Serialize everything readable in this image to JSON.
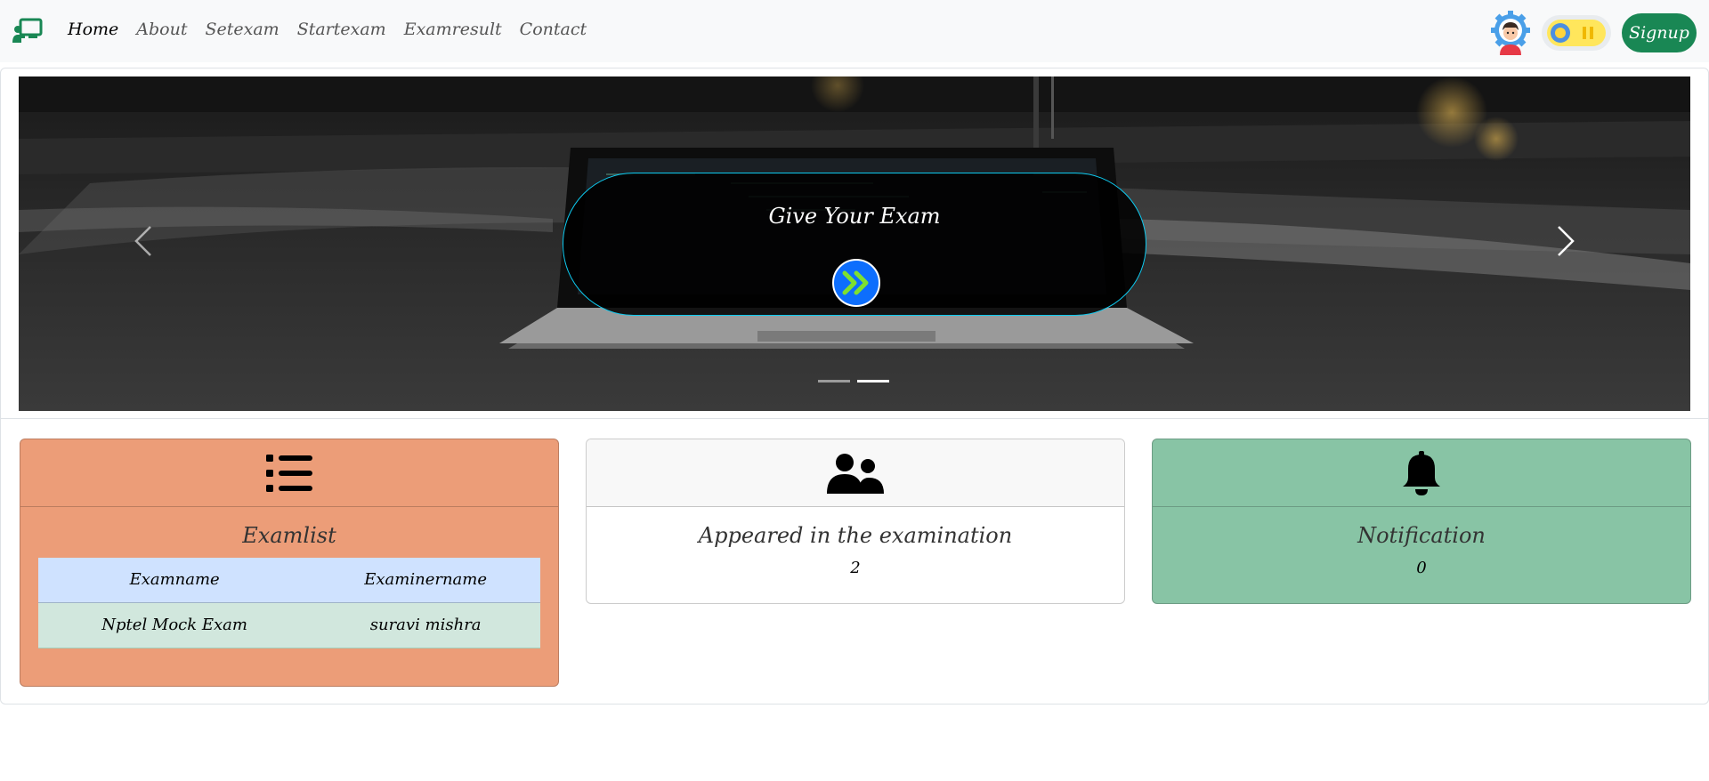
{
  "nav": {
    "brand_icon": "teacher-presentation-icon",
    "links": [
      "Home",
      "About",
      "Setexam",
      "Startexam",
      "Examresult",
      "Contact"
    ],
    "active": "Home",
    "signup_label": "Signup",
    "avatar_icon": "user-gear-avatar-icon",
    "theme_toggle_icon": "theme-toggle-icon"
  },
  "hero": {
    "caption_title": "Give Your Exam",
    "go_icon": "angles-right-icon",
    "slide_count": 2,
    "active_slide": 2
  },
  "cards": {
    "examlist": {
      "icon": "list-icon",
      "title": "Examlist",
      "columns": [
        "Examname",
        "Examinername"
      ],
      "rows": [
        [
          "Nptel Mock Exam",
          "suravi mishra"
        ]
      ]
    },
    "appeared": {
      "icon": "user-group-icon",
      "title": "Appeared in the examination",
      "value": "2"
    },
    "notification": {
      "icon": "bell-icon",
      "title": "Notification",
      "value": "0"
    }
  },
  "colors": {
    "brand_green": "#198754",
    "examlist_bg": "#ec9d78",
    "notification_bg": "#88c4a5",
    "caption_border": "#0dcaf0",
    "go_button": "#0d6efd",
    "table_header": "#cfe2ff",
    "table_row": "#d1e7dd"
  }
}
